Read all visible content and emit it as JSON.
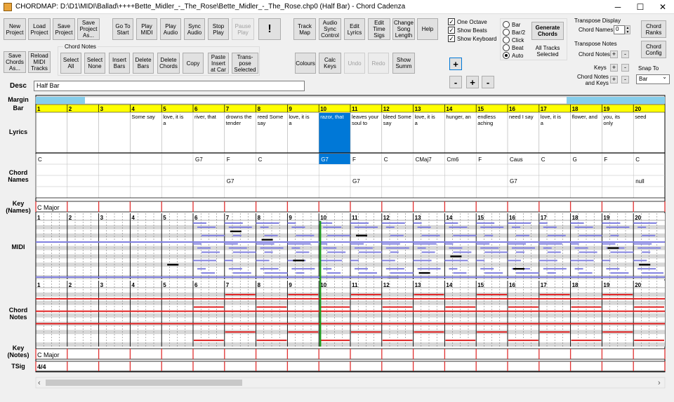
{
  "window": {
    "title": "CHORDMAP: D:\\D1\\MIDI\\Ballad\\++++Bette_Midler_-_The_Rose\\Bette_Midler_-_The_Rose.chp0 (Half Bar) - Chord Cadenza",
    "minimize": "─",
    "maximize": "☐",
    "close": "✕"
  },
  "toolbar": {
    "new_project": "New\nProject",
    "load_project": "Load\nProject",
    "save_project": "Save\nProject",
    "save_project_as": "Save\nProject\nAs...",
    "goto_start": "Go To\nStart",
    "play_midi": "Play\nMIDI",
    "play_audio": "Play\nAudio",
    "sync_audio": "Sync\nAudio",
    "stop_play": "Stop\nPlay",
    "pause_play": "Pause\nPlay",
    "alert": "!",
    "save_chords_as": "Save\nChords\nAs...",
    "reload_midi_tracks": "Reload\nMIDI\nTracks",
    "chord_notes_group": "Chord Notes",
    "select_all": "Select\nAll",
    "select_none": "Select\nNone",
    "insert_bars": "Insert\nBars",
    "delete_bars": "Delete\nBars",
    "delete_chords": "Delete\nChords",
    "copy": "Copy",
    "paste_insert": "Paste\nInsert\nat Car",
    "transpose_selected": "Trans-\npose\nSelected",
    "track_map": "Track\nMap",
    "audio_sync_control": "Audio\nSync\nControl",
    "edit_lyrics": "Edit\nLyrics",
    "edit_time_sigs": "Edit\nTime\nSigs",
    "change_song_length": "Change\nSong\nLength",
    "help": "Help",
    "colours": "Colours",
    "calc_keys": "Calc\nKeys",
    "undo": "Undo",
    "redo": "Redo",
    "show_summ": "Show\nSumm",
    "plus": "+",
    "minus": "-"
  },
  "options": {
    "one_octave": "One Octave",
    "show_beats": "Show Beats",
    "show_keyboard": "Show Keyboard"
  },
  "snap_radios": [
    "Bar",
    "Bar/2",
    "Click",
    "Beat",
    "Auto"
  ],
  "generate": {
    "button": "Generate\nChords",
    "note": "All Tracks\nSelected"
  },
  "transpose": {
    "display_title": "Transpose Display",
    "chord_names": "Chord Names",
    "chord_names_value": "0",
    "notes_title": "Transpose Notes",
    "chord_notes": "Chord Notes",
    "keys": "Keys",
    "chord_notes_and_keys": "Chord Notes\nand Keys"
  },
  "right": {
    "chord_ranks": "Chord\nRanks",
    "chord_config": "Chord\nConfig",
    "snap_to": "Snap To",
    "snap_value": "Bar",
    "dropdown_arrow": "⌄"
  },
  "desc": {
    "label": "Desc",
    "value": "Half Bar"
  },
  "rows": {
    "margin": "Margin",
    "bar": "Bar",
    "lyrics": "Lyrics",
    "chord_names": "Chord\nNames",
    "key_names": "Key\n(Names)",
    "midi": "MIDI",
    "chord_notes": "Chord\nNotes",
    "key_notes": "Key\n(Notes)",
    "tsig": "TSig"
  },
  "grid": {
    "bars": [
      "1",
      "2",
      "3",
      "4",
      "5",
      "6",
      "7",
      "8",
      "9",
      "10",
      "11",
      "12",
      "13",
      "14",
      "15",
      "16",
      "17",
      "18",
      "19",
      "20"
    ],
    "lyrics": [
      "",
      "",
      "",
      "Some say",
      "love, it is a",
      "river, that",
      "drowns the tender",
      "reed Some say",
      "love, it is a",
      "razor, that",
      "leaves your soul to",
      "bleed Some say",
      "love, it is a",
      "hunger, an",
      "endless aching",
      "need I say",
      "love, it is a",
      "flower, and",
      "you, its only",
      "seed"
    ],
    "chords1": [
      "C",
      "",
      "",
      "",
      "",
      "G7",
      "F",
      "C",
      "",
      "G7",
      "F",
      "C",
      "CMaj7",
      "Cm6",
      "F",
      "Caus",
      "C",
      "G",
      "F",
      "C"
    ],
    "chords2": [
      "",
      "",
      "",
      "",
      "",
      "",
      "G7",
      "",
      "",
      "",
      "G7",
      "",
      "",
      "",
      "",
      "G7",
      "",
      "",
      "",
      "null"
    ],
    "key_names": "C Major",
    "key_notes": "C Major",
    "tsig": "4/4",
    "scroll_left": "‹",
    "scroll_right": "›"
  },
  "colors": {
    "accent": "#0078d7",
    "bar_yellow": "#ffff00",
    "margin_blue": "#87ceeb",
    "bar_red": "#e03030",
    "cursor_green": "#1f9a1f",
    "note_blue": "#8080e0",
    "chord_red": "#e02020"
  }
}
